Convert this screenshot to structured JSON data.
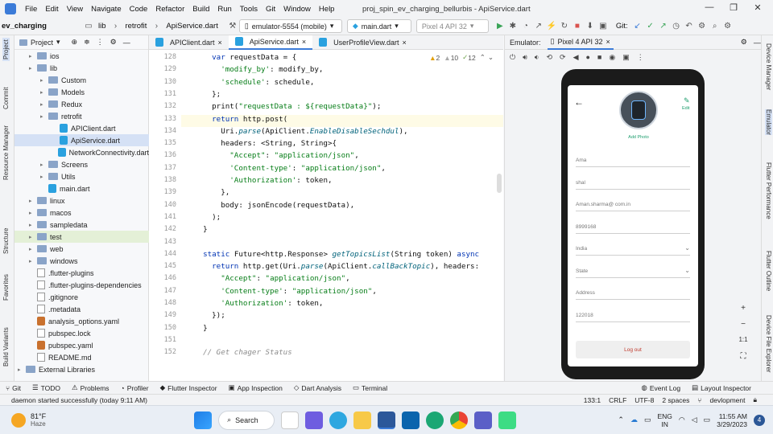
{
  "menubar": {
    "items": [
      "File",
      "Edit",
      "View",
      "Navigate",
      "Code",
      "Refactor",
      "Build",
      "Run",
      "Tools",
      "Git",
      "Window",
      "Help"
    ],
    "window_title": "proj_spin_ev_charging_bellurbis - ApiService.dart"
  },
  "toolbar": {
    "project": "ev_charging",
    "breadcrumbs": [
      "lib",
      "retrofit",
      "ApiService.dart"
    ],
    "device": "emulator-5554 (mobile)",
    "run_config": "main.dart",
    "avd": "Pixel 4 API 32",
    "git_label": "Git:"
  },
  "left_tools": [
    "Project",
    "Commit",
    "Resource Manager",
    "Structure",
    "Favorites",
    "Build Variants"
  ],
  "right_tools": [
    "Device Manager",
    "Emulator",
    "Flutter Performance",
    "Flutter Outline",
    "Device File Explorer"
  ],
  "project_panel": {
    "title": "Project",
    "tree": [
      {
        "label": "ios",
        "type": "folder",
        "depth": 1
      },
      {
        "label": "lib",
        "type": "folder",
        "depth": 1
      },
      {
        "label": "Custom",
        "type": "folder",
        "depth": 2
      },
      {
        "label": "Models",
        "type": "folder",
        "depth": 2
      },
      {
        "label": "Redux",
        "type": "folder",
        "depth": 2
      },
      {
        "label": "retrofit",
        "type": "folder",
        "depth": 2
      },
      {
        "label": "APIClient.dart",
        "type": "dart",
        "depth": 3
      },
      {
        "label": "ApiService.dart",
        "type": "dart",
        "depth": 3,
        "selected": true
      },
      {
        "label": "NetworkConnectivity.dart",
        "type": "dart",
        "depth": 3
      },
      {
        "label": "Screens",
        "type": "folder",
        "depth": 2
      },
      {
        "label": "Utils",
        "type": "folder",
        "depth": 2
      },
      {
        "label": "main.dart",
        "type": "dart",
        "depth": 2
      },
      {
        "label": "linux",
        "type": "folder",
        "depth": 1
      },
      {
        "label": "macos",
        "type": "folder",
        "depth": 1
      },
      {
        "label": "sampledata",
        "type": "folder",
        "depth": 1
      },
      {
        "label": "test",
        "type": "folder",
        "depth": 1,
        "highlight": true
      },
      {
        "label": "web",
        "type": "folder",
        "depth": 1
      },
      {
        "label": "windows",
        "type": "folder",
        "depth": 1
      },
      {
        "label": ".flutter-plugins",
        "type": "file",
        "depth": 1
      },
      {
        "label": ".flutter-plugins-dependencies",
        "type": "file",
        "depth": 1
      },
      {
        "label": ".gitignore",
        "type": "file",
        "depth": 1
      },
      {
        "label": ".metadata",
        "type": "file",
        "depth": 1
      },
      {
        "label": "analysis_options.yaml",
        "type": "yaml",
        "depth": 1
      },
      {
        "label": "pubspec.lock",
        "type": "file",
        "depth": 1
      },
      {
        "label": "pubspec.yaml",
        "type": "yaml",
        "depth": 1
      },
      {
        "label": "README.md",
        "type": "file",
        "depth": 1
      },
      {
        "label": "External Libraries",
        "type": "folder",
        "depth": 0
      }
    ]
  },
  "editor": {
    "tabs": [
      "APIClient.dart",
      "ApiService.dart",
      "UserProfileView.dart"
    ],
    "active_tab": 1,
    "inspections": {
      "warnings": "2",
      "weak": "10",
      "typos": "12"
    },
    "line_numbers": [
      "128",
      "129",
      "130",
      "131",
      "132",
      "133",
      "134",
      "135",
      "136",
      "137",
      "138",
      "139",
      "140",
      "141",
      "142",
      "143",
      "144",
      "145",
      "146",
      "147",
      "148",
      "149",
      "150",
      "151",
      "152"
    ],
    "current_line_index": 5,
    "lines": [
      [
        [
          "    ",
          ""
        ],
        [
          "var ",
          "kw"
        ],
        [
          "requestData = {",
          ""
        ]
      ],
      [
        [
          "      ",
          ""
        ],
        [
          "'modify_by'",
          "str"
        ],
        [
          ": modify_by,",
          ""
        ]
      ],
      [
        [
          "      ",
          ""
        ],
        [
          "'schedule'",
          "str"
        ],
        [
          ": schedule,",
          ""
        ]
      ],
      [
        [
          "    };",
          ""
        ]
      ],
      [
        [
          "    print(",
          ""
        ],
        [
          "\"requestData : ${requestData}\"",
          "str"
        ],
        [
          ");",
          ""
        ]
      ],
      [
        [
          "    ",
          ""
        ],
        [
          "return ",
          "kw"
        ],
        [
          "http.post(",
          ""
        ]
      ],
      [
        [
          "      Uri.",
          ""
        ],
        [
          "parse",
          "fn"
        ],
        [
          "(ApiClient.",
          ""
        ],
        [
          "EnableDisableSechdul",
          "fn"
        ],
        [
          "),",
          ""
        ]
      ],
      [
        [
          "      headers: <String, String>{",
          ""
        ]
      ],
      [
        [
          "        ",
          ""
        ],
        [
          "\"Accept\"",
          "str"
        ],
        [
          ": ",
          ""
        ],
        [
          "\"application/json\"",
          "str"
        ],
        [
          ",",
          ""
        ]
      ],
      [
        [
          "        ",
          ""
        ],
        [
          "'Content-type'",
          "str"
        ],
        [
          ": ",
          ""
        ],
        [
          "\"application/json\"",
          "str"
        ],
        [
          ",",
          ""
        ]
      ],
      [
        [
          "        ",
          ""
        ],
        [
          "'Authorization'",
          "str"
        ],
        [
          ": token,",
          ""
        ]
      ],
      [
        [
          "      },",
          ""
        ]
      ],
      [
        [
          "      body: jsonEncode(requestData),",
          ""
        ]
      ],
      [
        [
          "    );",
          ""
        ]
      ],
      [
        [
          "  }",
          ""
        ]
      ],
      [
        [
          "",
          ""
        ]
      ],
      [
        [
          "  ",
          ""
        ],
        [
          "static ",
          "kw"
        ],
        [
          "Future<http.Response> ",
          ""
        ],
        [
          "getTopicsList",
          "fn"
        ],
        [
          "(String token) ",
          ""
        ],
        [
          "async",
          "kw"
        ]
      ],
      [
        [
          "    ",
          ""
        ],
        [
          "return ",
          "kw"
        ],
        [
          "http.get(Uri.",
          ""
        ],
        [
          "parse",
          "fn"
        ],
        [
          "(ApiClient.",
          ""
        ],
        [
          "callBackTopic",
          "fn"
        ],
        [
          "), headers:",
          ""
        ]
      ],
      [
        [
          "      ",
          ""
        ],
        [
          "\"Accept\"",
          "str"
        ],
        [
          ": ",
          ""
        ],
        [
          "\"application/json\"",
          "str"
        ],
        [
          ",",
          ""
        ]
      ],
      [
        [
          "      ",
          ""
        ],
        [
          "'Content-type'",
          "str"
        ],
        [
          ": ",
          ""
        ],
        [
          "\"application/json\"",
          "str"
        ],
        [
          ",",
          ""
        ]
      ],
      [
        [
          "      ",
          ""
        ],
        [
          "'Authorization'",
          "str"
        ],
        [
          ": token,",
          ""
        ]
      ],
      [
        [
          "    });",
          ""
        ]
      ],
      [
        [
          "  }",
          ""
        ]
      ],
      [
        [
          "",
          ""
        ]
      ],
      [
        [
          "  ",
          ""
        ],
        [
          "// Get chager Status",
          "cm"
        ]
      ]
    ]
  },
  "emulator": {
    "label": "Emulator:",
    "device_tab": "Pixel 4 API 32",
    "app": {
      "edit_label": "Edit",
      "add_photo": "Add Photo",
      "fields": [
        "Ama",
        "shal",
        "Aman.sharma@ com.in",
        "8999168",
        "India",
        "State",
        "Address",
        "122018"
      ],
      "dropdown_fields": [
        4,
        5
      ],
      "logout": "Log out"
    },
    "zoom_ratio": "1:1"
  },
  "bottom_tools": [
    "Git",
    "TODO",
    "Problems",
    "Profiler",
    "Flutter Inspector",
    "App Inspection",
    "Dart Analysis",
    "Terminal"
  ],
  "bottom_right_tools": [
    "Event Log",
    "Layout Inspector"
  ],
  "status": {
    "message": "daemon started successfully (today 9:11 AM)",
    "position": "133:1",
    "line_sep": "CRLF",
    "encoding": "UTF-8",
    "indent": "2 spaces",
    "branch": "devlopment"
  },
  "taskbar": {
    "weather_temp": "81°F",
    "weather_desc": "Haze",
    "search": "Search",
    "lang": "ENG",
    "region": "IN",
    "time": "11:55 AM",
    "date": "3/29/2023",
    "notifications": "4"
  },
  "colors": {
    "accent": "#3b7bd8",
    "keyword": "#0033b3",
    "string": "#067d17"
  }
}
